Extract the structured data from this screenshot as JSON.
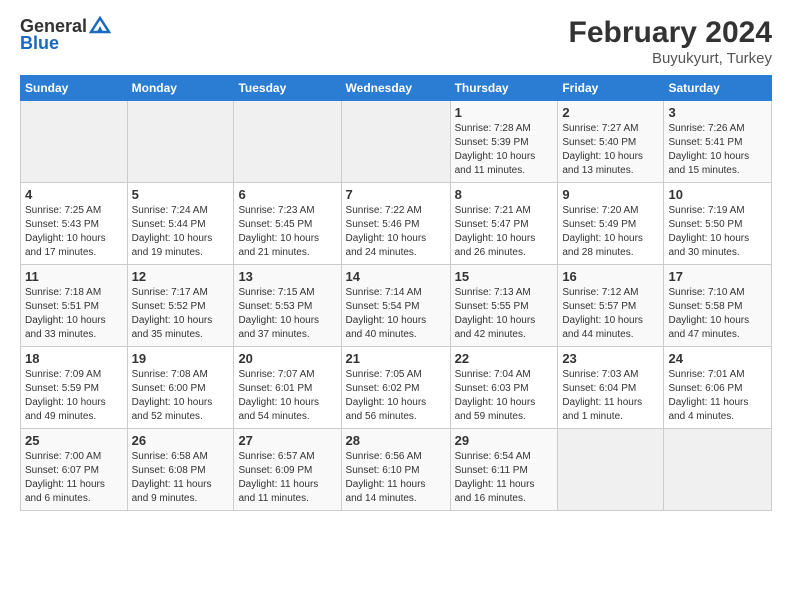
{
  "header": {
    "logo_line1": "General",
    "logo_line2": "Blue",
    "title": "February 2024",
    "subtitle": "Buyukyurt, Turkey"
  },
  "days_of_week": [
    "Sunday",
    "Monday",
    "Tuesday",
    "Wednesday",
    "Thursday",
    "Friday",
    "Saturday"
  ],
  "weeks": [
    [
      {
        "num": "",
        "info": ""
      },
      {
        "num": "",
        "info": ""
      },
      {
        "num": "",
        "info": ""
      },
      {
        "num": "",
        "info": ""
      },
      {
        "num": "1",
        "info": "Sunrise: 7:28 AM\nSunset: 5:39 PM\nDaylight: 10 hours\nand 11 minutes."
      },
      {
        "num": "2",
        "info": "Sunrise: 7:27 AM\nSunset: 5:40 PM\nDaylight: 10 hours\nand 13 minutes."
      },
      {
        "num": "3",
        "info": "Sunrise: 7:26 AM\nSunset: 5:41 PM\nDaylight: 10 hours\nand 15 minutes."
      }
    ],
    [
      {
        "num": "4",
        "info": "Sunrise: 7:25 AM\nSunset: 5:43 PM\nDaylight: 10 hours\nand 17 minutes."
      },
      {
        "num": "5",
        "info": "Sunrise: 7:24 AM\nSunset: 5:44 PM\nDaylight: 10 hours\nand 19 minutes."
      },
      {
        "num": "6",
        "info": "Sunrise: 7:23 AM\nSunset: 5:45 PM\nDaylight: 10 hours\nand 21 minutes."
      },
      {
        "num": "7",
        "info": "Sunrise: 7:22 AM\nSunset: 5:46 PM\nDaylight: 10 hours\nand 24 minutes."
      },
      {
        "num": "8",
        "info": "Sunrise: 7:21 AM\nSunset: 5:47 PM\nDaylight: 10 hours\nand 26 minutes."
      },
      {
        "num": "9",
        "info": "Sunrise: 7:20 AM\nSunset: 5:49 PM\nDaylight: 10 hours\nand 28 minutes."
      },
      {
        "num": "10",
        "info": "Sunrise: 7:19 AM\nSunset: 5:50 PM\nDaylight: 10 hours\nand 30 minutes."
      }
    ],
    [
      {
        "num": "11",
        "info": "Sunrise: 7:18 AM\nSunset: 5:51 PM\nDaylight: 10 hours\nand 33 minutes."
      },
      {
        "num": "12",
        "info": "Sunrise: 7:17 AM\nSunset: 5:52 PM\nDaylight: 10 hours\nand 35 minutes."
      },
      {
        "num": "13",
        "info": "Sunrise: 7:15 AM\nSunset: 5:53 PM\nDaylight: 10 hours\nand 37 minutes."
      },
      {
        "num": "14",
        "info": "Sunrise: 7:14 AM\nSunset: 5:54 PM\nDaylight: 10 hours\nand 40 minutes."
      },
      {
        "num": "15",
        "info": "Sunrise: 7:13 AM\nSunset: 5:55 PM\nDaylight: 10 hours\nand 42 minutes."
      },
      {
        "num": "16",
        "info": "Sunrise: 7:12 AM\nSunset: 5:57 PM\nDaylight: 10 hours\nand 44 minutes."
      },
      {
        "num": "17",
        "info": "Sunrise: 7:10 AM\nSunset: 5:58 PM\nDaylight: 10 hours\nand 47 minutes."
      }
    ],
    [
      {
        "num": "18",
        "info": "Sunrise: 7:09 AM\nSunset: 5:59 PM\nDaylight: 10 hours\nand 49 minutes."
      },
      {
        "num": "19",
        "info": "Sunrise: 7:08 AM\nSunset: 6:00 PM\nDaylight: 10 hours\nand 52 minutes."
      },
      {
        "num": "20",
        "info": "Sunrise: 7:07 AM\nSunset: 6:01 PM\nDaylight: 10 hours\nand 54 minutes."
      },
      {
        "num": "21",
        "info": "Sunrise: 7:05 AM\nSunset: 6:02 PM\nDaylight: 10 hours\nand 56 minutes."
      },
      {
        "num": "22",
        "info": "Sunrise: 7:04 AM\nSunset: 6:03 PM\nDaylight: 10 hours\nand 59 minutes."
      },
      {
        "num": "23",
        "info": "Sunrise: 7:03 AM\nSunset: 6:04 PM\nDaylight: 11 hours\nand 1 minute."
      },
      {
        "num": "24",
        "info": "Sunrise: 7:01 AM\nSunset: 6:06 PM\nDaylight: 11 hours\nand 4 minutes."
      }
    ],
    [
      {
        "num": "25",
        "info": "Sunrise: 7:00 AM\nSunset: 6:07 PM\nDaylight: 11 hours\nand 6 minutes."
      },
      {
        "num": "26",
        "info": "Sunrise: 6:58 AM\nSunset: 6:08 PM\nDaylight: 11 hours\nand 9 minutes."
      },
      {
        "num": "27",
        "info": "Sunrise: 6:57 AM\nSunset: 6:09 PM\nDaylight: 11 hours\nand 11 minutes."
      },
      {
        "num": "28",
        "info": "Sunrise: 6:56 AM\nSunset: 6:10 PM\nDaylight: 11 hours\nand 14 minutes."
      },
      {
        "num": "29",
        "info": "Sunrise: 6:54 AM\nSunset: 6:11 PM\nDaylight: 11 hours\nand 16 minutes."
      },
      {
        "num": "",
        "info": ""
      },
      {
        "num": "",
        "info": ""
      }
    ]
  ]
}
